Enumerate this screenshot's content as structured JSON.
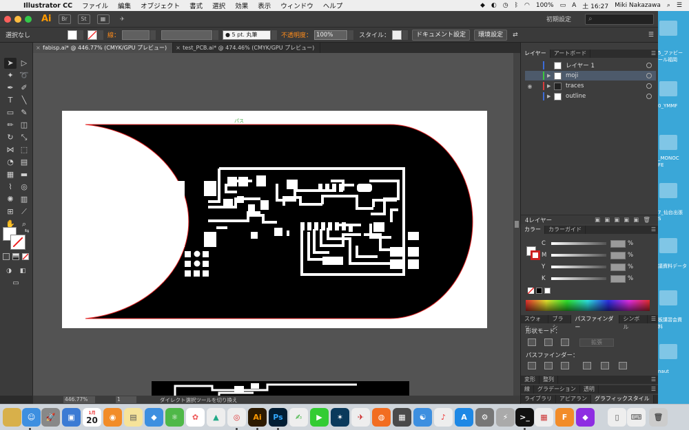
{
  "menubar": {
    "app_name": "Illustrator CC",
    "items": [
      "ファイル",
      "編集",
      "オブジェクト",
      "書式",
      "選択",
      "効果",
      "表示",
      "ウィンドウ",
      "ヘルプ"
    ],
    "battery": "100%",
    "input_mode": "A",
    "clock": "土 16:27",
    "user": "Miki Nakazawa"
  },
  "appbar": {
    "logo": "Ai",
    "br_label": "Br",
    "workspace": "初期設定",
    "search_glyph": "⌕"
  },
  "controlbar": {
    "selection": "選択なし",
    "stroke_label": "線：",
    "brush": "● 5 pt. 丸筆",
    "opacity_label": "不透明度：",
    "opacity_value": "100%",
    "style_label": "スタイル：",
    "doc_settings": "ドキュメント設定",
    "prefs": "環境設定"
  },
  "tabs": [
    {
      "label": "fabisp.ai* @ 446.77% (CMYK/GPU プレビュー)",
      "close": "×"
    },
    {
      "label": "test_PCB.ai* @ 474.46% (CMYK/GPU プレビュー)",
      "close": "×"
    }
  ],
  "canvas": {
    "path_hint": "パス",
    "colors": {
      "board": "#000000",
      "artboard": "#ffffff",
      "outline": "#e02020",
      "pasteboard": "#535353"
    }
  },
  "statusbar": {
    "zoom": "446.77%",
    "page": "1",
    "message": "ダイレクト選択ツールを切り換え"
  },
  "layers_panel": {
    "tabs": [
      "レイヤー",
      "アートボード"
    ],
    "layers": [
      {
        "name": "レイヤー 1",
        "color": "#3c6cd8",
        "visible": false,
        "selected": false
      },
      {
        "name": "moji",
        "color": "#3cc83c",
        "visible": false,
        "selected": true
      },
      {
        "name": "traces",
        "color": "#d83c3c",
        "visible": true,
        "selected": false
      },
      {
        "name": "outline",
        "color": "#3c6cd8",
        "visible": false,
        "selected": false
      }
    ],
    "count": "4レイヤー"
  },
  "color_panel": {
    "tabs": [
      "カラー",
      "カラーガイド"
    ],
    "channels": [
      {
        "label": "C",
        "unit": "%"
      },
      {
        "label": "M",
        "unit": "%"
      },
      {
        "label": "Y",
        "unit": "%"
      },
      {
        "label": "K",
        "unit": "%"
      }
    ]
  },
  "pathfinder_panel": {
    "tabs": [
      "スウォッ",
      "ブラシ",
      "パスファインダー",
      "シンボル"
    ],
    "shape_modes": "形状モード：",
    "pathfinders": "パスファインダー：",
    "expand": "拡張"
  },
  "collapsed_panels": {
    "transform": [
      "変形",
      "整列"
    ],
    "stroke": [
      "線",
      "グラデーション",
      "透明"
    ],
    "library": [
      "ライブラリ",
      "アピアラン",
      "グラフィックスタイル"
    ]
  },
  "desktop": {
    "labels": [
      "5_ファビー",
      "ール福岡",
      "0_YMMF",
      "_MONOC",
      "FE",
      "7_仙台出張",
      "S",
      "議資料データ",
      "板講習会資",
      "料",
      "naut"
    ]
  },
  "dock": {
    "calendar_month": "1月",
    "calendar_day": "20",
    "ai": "Ai",
    "ps": "Ps"
  }
}
